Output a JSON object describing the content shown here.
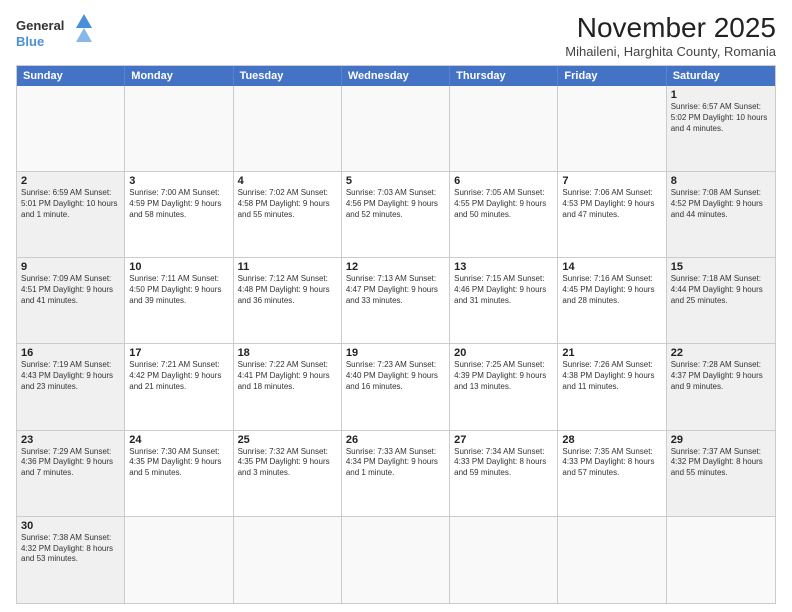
{
  "header": {
    "logo": {
      "general": "General",
      "blue": "Blue"
    },
    "title": "November 2025",
    "location": "Mihaileni, Harghita County, Romania"
  },
  "dayHeaders": [
    "Sunday",
    "Monday",
    "Tuesday",
    "Wednesday",
    "Thursday",
    "Friday",
    "Saturday"
  ],
  "weeks": [
    [
      {
        "day": "",
        "info": "",
        "type": "empty"
      },
      {
        "day": "",
        "info": "",
        "type": "empty"
      },
      {
        "day": "",
        "info": "",
        "type": "empty"
      },
      {
        "day": "",
        "info": "",
        "type": "empty"
      },
      {
        "day": "",
        "info": "",
        "type": "empty"
      },
      {
        "day": "",
        "info": "",
        "type": "empty"
      },
      {
        "day": "1",
        "info": "Sunrise: 6:57 AM\nSunset: 5:02 PM\nDaylight: 10 hours\nand 4 minutes.",
        "type": "weekend"
      }
    ],
    [
      {
        "day": "2",
        "info": "Sunrise: 6:59 AM\nSunset: 5:01 PM\nDaylight: 10 hours\nand 1 minute.",
        "type": "weekend"
      },
      {
        "day": "3",
        "info": "Sunrise: 7:00 AM\nSunset: 4:59 PM\nDaylight: 9 hours\nand 58 minutes.",
        "type": "weekday"
      },
      {
        "day": "4",
        "info": "Sunrise: 7:02 AM\nSunset: 4:58 PM\nDaylight: 9 hours\nand 55 minutes.",
        "type": "weekday"
      },
      {
        "day": "5",
        "info": "Sunrise: 7:03 AM\nSunset: 4:56 PM\nDaylight: 9 hours\nand 52 minutes.",
        "type": "weekday"
      },
      {
        "day": "6",
        "info": "Sunrise: 7:05 AM\nSunset: 4:55 PM\nDaylight: 9 hours\nand 50 minutes.",
        "type": "weekday"
      },
      {
        "day": "7",
        "info": "Sunrise: 7:06 AM\nSunset: 4:53 PM\nDaylight: 9 hours\nand 47 minutes.",
        "type": "weekday"
      },
      {
        "day": "8",
        "info": "Sunrise: 7:08 AM\nSunset: 4:52 PM\nDaylight: 9 hours\nand 44 minutes.",
        "type": "weekend"
      }
    ],
    [
      {
        "day": "9",
        "info": "Sunrise: 7:09 AM\nSunset: 4:51 PM\nDaylight: 9 hours\nand 41 minutes.",
        "type": "weekend"
      },
      {
        "day": "10",
        "info": "Sunrise: 7:11 AM\nSunset: 4:50 PM\nDaylight: 9 hours\nand 39 minutes.",
        "type": "weekday"
      },
      {
        "day": "11",
        "info": "Sunrise: 7:12 AM\nSunset: 4:48 PM\nDaylight: 9 hours\nand 36 minutes.",
        "type": "weekday"
      },
      {
        "day": "12",
        "info": "Sunrise: 7:13 AM\nSunset: 4:47 PM\nDaylight: 9 hours\nand 33 minutes.",
        "type": "weekday"
      },
      {
        "day": "13",
        "info": "Sunrise: 7:15 AM\nSunset: 4:46 PM\nDaylight: 9 hours\nand 31 minutes.",
        "type": "weekday"
      },
      {
        "day": "14",
        "info": "Sunrise: 7:16 AM\nSunset: 4:45 PM\nDaylight: 9 hours\nand 28 minutes.",
        "type": "weekday"
      },
      {
        "day": "15",
        "info": "Sunrise: 7:18 AM\nSunset: 4:44 PM\nDaylight: 9 hours\nand 25 minutes.",
        "type": "weekend"
      }
    ],
    [
      {
        "day": "16",
        "info": "Sunrise: 7:19 AM\nSunset: 4:43 PM\nDaylight: 9 hours\nand 23 minutes.",
        "type": "weekend"
      },
      {
        "day": "17",
        "info": "Sunrise: 7:21 AM\nSunset: 4:42 PM\nDaylight: 9 hours\nand 21 minutes.",
        "type": "weekday"
      },
      {
        "day": "18",
        "info": "Sunrise: 7:22 AM\nSunset: 4:41 PM\nDaylight: 9 hours\nand 18 minutes.",
        "type": "weekday"
      },
      {
        "day": "19",
        "info": "Sunrise: 7:23 AM\nSunset: 4:40 PM\nDaylight: 9 hours\nand 16 minutes.",
        "type": "weekday"
      },
      {
        "day": "20",
        "info": "Sunrise: 7:25 AM\nSunset: 4:39 PM\nDaylight: 9 hours\nand 13 minutes.",
        "type": "weekday"
      },
      {
        "day": "21",
        "info": "Sunrise: 7:26 AM\nSunset: 4:38 PM\nDaylight: 9 hours\nand 11 minutes.",
        "type": "weekday"
      },
      {
        "day": "22",
        "info": "Sunrise: 7:28 AM\nSunset: 4:37 PM\nDaylight: 9 hours\nand 9 minutes.",
        "type": "weekend"
      }
    ],
    [
      {
        "day": "23",
        "info": "Sunrise: 7:29 AM\nSunset: 4:36 PM\nDaylight: 9 hours\nand 7 minutes.",
        "type": "weekend"
      },
      {
        "day": "24",
        "info": "Sunrise: 7:30 AM\nSunset: 4:35 PM\nDaylight: 9 hours\nand 5 minutes.",
        "type": "weekday"
      },
      {
        "day": "25",
        "info": "Sunrise: 7:32 AM\nSunset: 4:35 PM\nDaylight: 9 hours\nand 3 minutes.",
        "type": "weekday"
      },
      {
        "day": "26",
        "info": "Sunrise: 7:33 AM\nSunset: 4:34 PM\nDaylight: 9 hours\nand 1 minute.",
        "type": "weekday"
      },
      {
        "day": "27",
        "info": "Sunrise: 7:34 AM\nSunset: 4:33 PM\nDaylight: 8 hours\nand 59 minutes.",
        "type": "weekday"
      },
      {
        "day": "28",
        "info": "Sunrise: 7:35 AM\nSunset: 4:33 PM\nDaylight: 8 hours\nand 57 minutes.",
        "type": "weekday"
      },
      {
        "day": "29",
        "info": "Sunrise: 7:37 AM\nSunset: 4:32 PM\nDaylight: 8 hours\nand 55 minutes.",
        "type": "weekend"
      }
    ],
    [
      {
        "day": "30",
        "info": "Sunrise: 7:38 AM\nSunset: 4:32 PM\nDaylight: 8 hours\nand 53 minutes.",
        "type": "weekend"
      },
      {
        "day": "",
        "info": "",
        "type": "empty"
      },
      {
        "day": "",
        "info": "",
        "type": "empty"
      },
      {
        "day": "",
        "info": "",
        "type": "empty"
      },
      {
        "day": "",
        "info": "",
        "type": "empty"
      },
      {
        "day": "",
        "info": "",
        "type": "empty"
      },
      {
        "day": "",
        "info": "",
        "type": "empty"
      }
    ]
  ]
}
